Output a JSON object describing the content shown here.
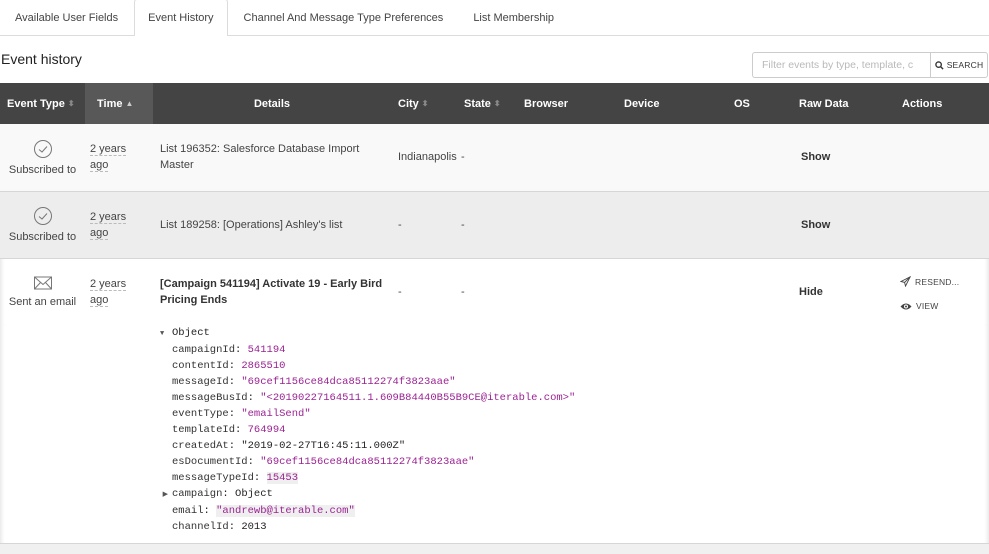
{
  "tabs": [
    {
      "label": "Available User Fields",
      "active": false
    },
    {
      "label": "Event History",
      "active": true
    },
    {
      "label": "Channel And Message Type Preferences",
      "active": false
    },
    {
      "label": "List Membership",
      "active": false
    }
  ],
  "page_title": "Event history",
  "search": {
    "placeholder": "Filter events by type, template, c",
    "value": "",
    "button_label": "SEARCH",
    "icon": "search-icon"
  },
  "table": {
    "columns": [
      {
        "label": "Event Type",
        "sortable": true,
        "sort": "none"
      },
      {
        "label": "Time",
        "sortable": true,
        "sort": "asc"
      },
      {
        "label": "Details",
        "sortable": false
      },
      {
        "label": "City",
        "sortable": true,
        "sort": "none"
      },
      {
        "label": "State",
        "sortable": true,
        "sort": "none"
      },
      {
        "label": "Browser",
        "sortable": false
      },
      {
        "label": "Device",
        "sortable": false
      },
      {
        "label": "OS",
        "sortable": false
      },
      {
        "label": "Raw Data",
        "sortable": false
      },
      {
        "label": "Actions",
        "sortable": false
      }
    ],
    "rows": [
      {
        "icon": "check-circle-icon",
        "event_type": "Subscribed to",
        "time_line1": "2 years",
        "time_line2": "ago",
        "details": "List 196352: Salesforce Database Import Master",
        "city": "Indianapolis",
        "state": "-",
        "browser": "",
        "device": "",
        "os": "",
        "raw_data": "Show"
      },
      {
        "icon": "check-circle-icon",
        "event_type": "Subscribed to",
        "time_line1": "2 years",
        "time_line2": "ago",
        "details": "List 189258: [Operations] Ashley's list",
        "city": "-",
        "state": "-",
        "browser": "",
        "device": "",
        "os": "",
        "raw_data": "Show"
      },
      {
        "icon": "envelope-icon",
        "event_type": "Sent an email",
        "time_line1": "2 years",
        "time_line2": "ago",
        "details": "[Campaign 541194] Activate 19 - Early Bird Pricing Ends",
        "city": "-",
        "state": "-",
        "browser": "",
        "device": "",
        "os": "",
        "raw_data": "Hide",
        "actions": [
          {
            "label": "RESEND...",
            "icon": "paper-plane-icon"
          },
          {
            "label": "VIEW",
            "icon": "eye-icon"
          }
        ]
      }
    ],
    "raw_object": {
      "root_label": "Object",
      "fields": [
        {
          "key": "campaignId",
          "value": "541194",
          "kind": "num"
        },
        {
          "key": "contentId",
          "value": "2865510",
          "kind": "num"
        },
        {
          "key": "messageId",
          "value": "\"69cef1156ce84dca85112274f3823aae\"",
          "kind": "str"
        },
        {
          "key": "messageBusId",
          "value": "\"<20190227164511.1.609B84440B55B9CE@iterable.com>\"",
          "kind": "str"
        },
        {
          "key": "eventType",
          "value": "\"emailSend\"",
          "kind": "str"
        },
        {
          "key": "templateId",
          "value": "764994",
          "kind": "num"
        },
        {
          "key": "createdAt",
          "value": "\"2019-02-27T16:45:11.000Z\"",
          "kind": "plain"
        },
        {
          "key": "esDocumentId",
          "value": "\"69cef1156ce84dca85112274f3823aae\"",
          "kind": "str"
        },
        {
          "key": "messageTypeId",
          "value": "15453",
          "kind": "num",
          "highlight": true
        },
        {
          "key": "campaign",
          "value": "Object",
          "kind": "plain",
          "collapsed": true
        },
        {
          "key": "email",
          "value": "\"andrewb@iterable.com\"",
          "kind": "str",
          "highlight": true
        },
        {
          "key": "channelId",
          "value": "2013",
          "kind": "plain"
        }
      ]
    }
  }
}
